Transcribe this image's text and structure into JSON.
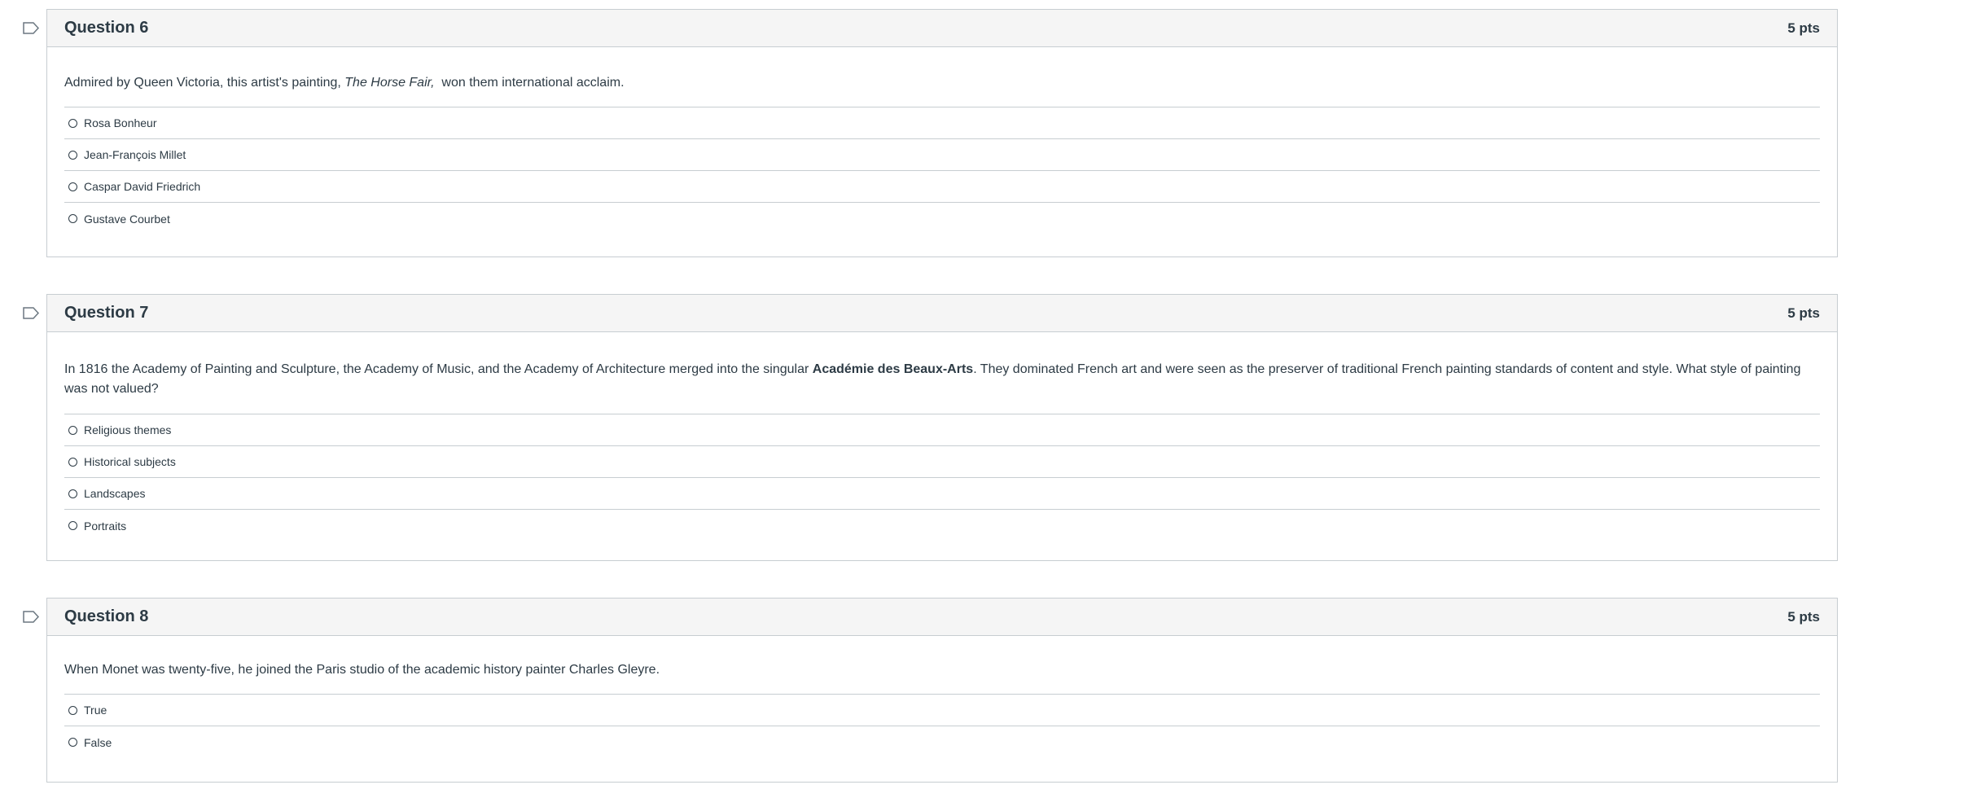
{
  "questions": [
    {
      "title": "Question 6",
      "points": "5 pts",
      "text_before": "Admired by Queen Victoria, this artist's painting, ",
      "text_em": "The Horse Fair,",
      "text_after": "  won them international acclaim.",
      "answers": [
        "Rosa Bonheur",
        "Jean-François Millet",
        "Caspar David Friedrich",
        "Gustave Courbet"
      ]
    },
    {
      "title": "Question 7",
      "points": "5 pts",
      "text_before": "In 1816 the Academy of Painting and Sculpture, the Academy of Music, and the Academy of Architecture merged into the singular ",
      "text_strong": "Académie des Beaux-Arts",
      "text_after": ". They dominated French art and were seen as the preserver of traditional French painting standards of content and style. What style of painting was not valued?",
      "answers": [
        "Religious themes",
        "Historical subjects",
        "Landscapes",
        "Portraits"
      ]
    },
    {
      "title": "Question 8",
      "points": "5 pts",
      "text": "When Monet was twenty-five, he joined the Paris studio of the academic history painter Charles Gleyre.",
      "answers": [
        "True",
        "False"
      ]
    }
  ],
  "icons": {
    "flag": "bookmark-flag-icon",
    "radio": "radio-button-icon"
  },
  "colors": {
    "text": "#2d3b45",
    "border": "#c7cdd1",
    "header_bg": "#f5f5f5",
    "flag_stroke": "#6b7780"
  }
}
